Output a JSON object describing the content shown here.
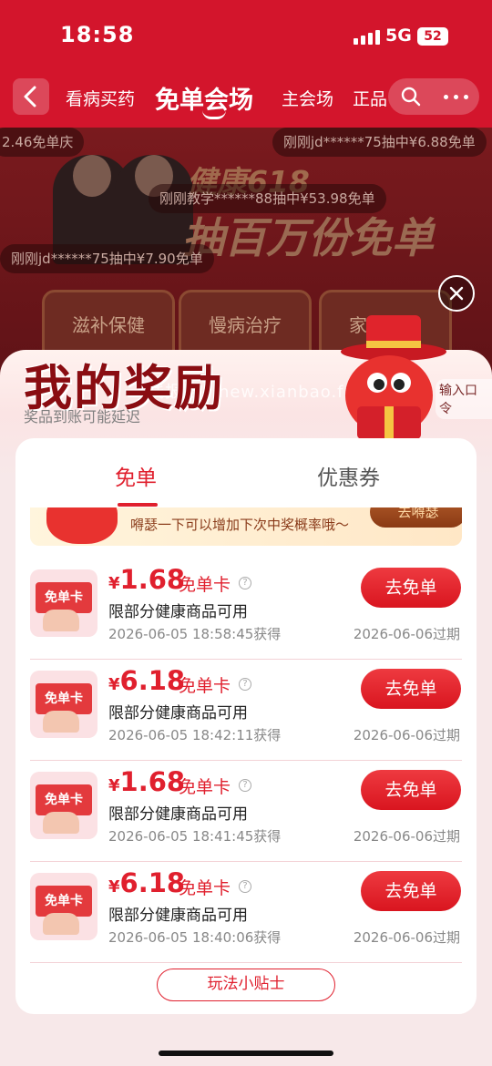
{
  "status": {
    "time": "18:58",
    "network": "5G",
    "battery": "52"
  },
  "nav": {
    "tabs": [
      {
        "label": "看病买药"
      },
      {
        "label": "免单会场"
      },
      {
        "label": "主会场"
      },
      {
        "label": "正品"
      }
    ]
  },
  "banner": {
    "title1": "健康618",
    "title2": "抽百万份免单",
    "tickers": [
      "2.46免单庆",
      "刚刚jd******75抽中¥6.88免单",
      "刚刚教学******88抽中¥53.98免单",
      "刚刚jd******75抽中¥7.90免单"
    ],
    "categories": [
      "滋补保健",
      "慢病治疗",
      "家有神单"
    ]
  },
  "modal": {
    "title": "我的奖励",
    "subtitle": "奖品到账可能延迟",
    "watermark": "线报酷 - new.xianbao.fun",
    "code_tag": "输入口令",
    "tabs": [
      {
        "label": "免单",
        "active": true
      },
      {
        "label": "优惠券",
        "active": false
      }
    ],
    "hint": {
      "text": "嘚瑟一下可以增加下次中奖概率哦～",
      "button": "去嘚瑟"
    },
    "coupon_image_label": "免单卡",
    "rewards": [
      {
        "currency": "¥",
        "amount": "1.68",
        "type": "免单卡",
        "desc": "限部分健康商品可用",
        "obtained": "2026-06-05 18:58:45获得",
        "action": "去免单",
        "expire": "2026-06-06过期"
      },
      {
        "currency": "¥",
        "amount": "6.18",
        "type": "免单卡",
        "desc": "限部分健康商品可用",
        "obtained": "2026-06-05 18:42:11获得",
        "action": "去免单",
        "expire": "2026-06-06过期"
      },
      {
        "currency": "¥",
        "amount": "1.68",
        "type": "免单卡",
        "desc": "限部分健康商品可用",
        "obtained": "2026-06-05 18:41:45获得",
        "action": "去免单",
        "expire": "2026-06-06过期"
      },
      {
        "currency": "¥",
        "amount": "6.18",
        "type": "免单卡",
        "desc": "限部分健康商品可用",
        "obtained": "2026-06-05 18:40:06获得",
        "action": "去免单",
        "expire": "2026-06-06过期"
      }
    ],
    "tips_button": "玩法小贴士"
  },
  "colors": {
    "brand": "#d3152c",
    "accent": "#e0202e",
    "title": "#8a0d12"
  },
  "icons": [
    "back-icon",
    "search-icon",
    "more-icon",
    "close-icon",
    "info-icon"
  ]
}
